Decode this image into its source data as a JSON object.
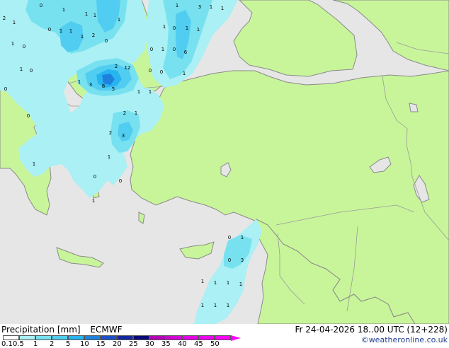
{
  "title": "Precipitation [mm]",
  "model": "ECMWF",
  "valid_time": "Fr 24-04-2026 18..00 UTC (12+228)",
  "credit": "©weatheronline.co.uk",
  "colors": {
    "land": "#c8f59a",
    "sea": "#e6e6e6",
    "coast": "#8a8a8a",
    "border": "#9a9a9a"
  },
  "scale": {
    "labels": [
      "0.1",
      "0.5",
      "1",
      "2",
      "5",
      "10",
      "15",
      "20",
      "25",
      "30",
      "35",
      "40",
      "45",
      "50"
    ],
    "colors": [
      "#ffffff",
      "#aaf0f5",
      "#78e1f0",
      "#50cdf0",
      "#28b4f0",
      "#1e82dc",
      "#1e50c8",
      "#1428a0",
      "#0a0a78",
      "#b400b4",
      "#d200d2",
      "#e600e6",
      "#f000f0",
      "#ff00ff"
    ]
  },
  "map_values": [
    "2",
    "1",
    "0",
    "1",
    "1",
    "1",
    "1",
    "3",
    "1",
    "1",
    "1",
    "0",
    "1",
    "1",
    "2",
    "0",
    "1",
    "1",
    "1",
    "0",
    "1",
    "1",
    "0",
    "1",
    "0",
    "6",
    "0",
    "0",
    "1",
    "0",
    "0",
    "2",
    "12",
    "1",
    "3",
    "8",
    "5",
    "1",
    "1",
    "0",
    "2",
    "1",
    "1",
    "2",
    "3",
    "1",
    "0",
    "0",
    "1",
    "0",
    "1",
    "1",
    "0",
    "0",
    "3",
    "1",
    "1",
    "1",
    "1",
    "1",
    "1",
    "1"
  ]
}
